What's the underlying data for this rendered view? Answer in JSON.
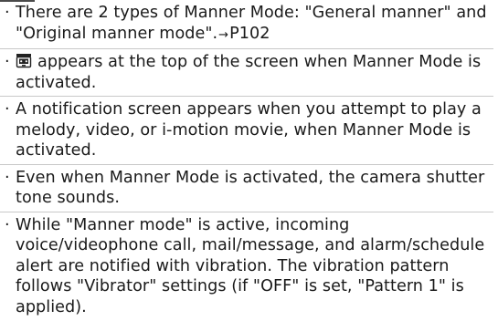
{
  "notes": {
    "bullet_char": "·",
    "arrow_char": "→",
    "items": [
      {
        "text_before": "There are 2 types of Manner Mode: \"General manner\" and \"Original manner mode\".",
        "page_ref": "P102"
      },
      {
        "icon": "manner-mode-icon",
        "text": "appears at the top of the screen when Manner Mode is activated."
      },
      {
        "text": "A notification screen appears when you attempt to play a melody, video, or i-motion movie, when Manner Mode is activated."
      },
      {
        "text": "Even when Manner Mode is activated, the camera shutter tone sounds."
      },
      {
        "text": "While \"Manner mode\" is active, incoming voice/videophone call, mail/message, and alarm/schedule alert are notified with vibration. The vibration pattern follows \"Vibrator\" settings (if \"OFF\" is set, \"Pattern 1\" is applied)."
      }
    ]
  }
}
